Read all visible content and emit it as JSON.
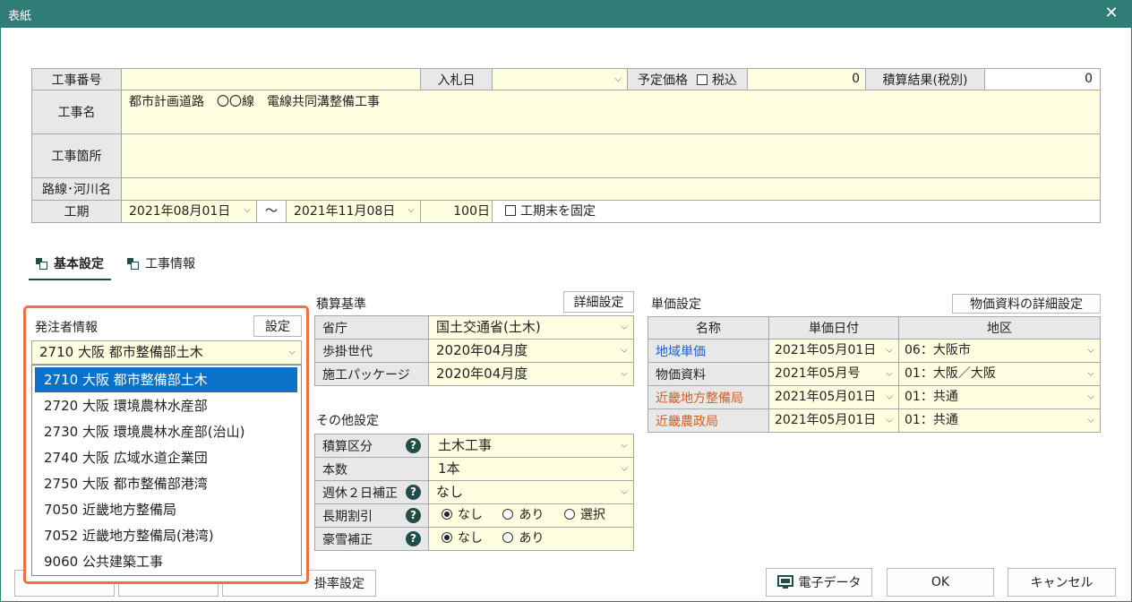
{
  "window": {
    "title": "表紙",
    "close_icon": "close-icon"
  },
  "header": {
    "koji_bango_label": "工事番号",
    "nyusatsu_label": "入札日",
    "yotei_kakaku_label": "予定価格",
    "zeikomi_label": "税込",
    "yotei_kakaku_value": "0",
    "sekisan_kekka_label": "積算結果(税別)",
    "sekisan_kekka_value": "0",
    "koji_mei_label": "工事名",
    "koji_mei_value": "都市計画道路　〇〇線　電線共同溝整備工事",
    "koji_kasho_label": "工事箇所",
    "rosen_label": "路線･河川名",
    "koki_label": "工期",
    "koki_start": "2021年08月01日",
    "koki_tilde": "～",
    "koki_end": "2021年11月08日",
    "koki_days": "100日",
    "koki_fix_label": "工期末を固定"
  },
  "tabs": {
    "basic": "基本設定",
    "koji_info": "工事情報"
  },
  "client": {
    "title": "発注者情報",
    "settings_button": "設定",
    "selected": "2710 大阪 都市整備部土木",
    "options": [
      "2710 大阪 都市整備部土木",
      "2720 大阪 環境農林水産部",
      "2730 大阪 環境農林水産部(治山)",
      "2740 大阪 広域水道企業団",
      "2750 大阪 都市整備部港湾",
      "7050 近畿地方整備局",
      "7052 近畿地方整備局(港湾)",
      "9060 公共建築工事"
    ]
  },
  "sekisan_kijun": {
    "title": "積算基準",
    "detail_button": "詳細設定",
    "rows": [
      {
        "label": "省庁",
        "value": "国土交通省(土木)"
      },
      {
        "label": "歩掛世代",
        "value": "2020年04月度"
      },
      {
        "label": "施工パッケージ",
        "value": "2020年04月度"
      }
    ]
  },
  "other": {
    "title": "その他設定",
    "sekisan_kubun_label": "積算区分",
    "sekisan_kubun_value": "土木工事",
    "honsu_label": "本数",
    "honsu_value": "1本",
    "shukyu_label": "週休２日補正",
    "shukyu_value": "なし",
    "choki_label": "長期割引",
    "gosetsu_label": "豪雪補正",
    "opt_nashi": "なし",
    "opt_ari": "あり",
    "opt_sentaku": "選択"
  },
  "tanka": {
    "title": "単価設定",
    "detail_button": "物価資料の詳細設定",
    "headers": [
      "名称",
      "単価日付",
      "地区"
    ],
    "rows": [
      {
        "name": "地域単価",
        "date": "2021年05月01日",
        "area": "06：大阪市"
      },
      {
        "name": "物価資料",
        "date": "2021年05月号",
        "area": "01：大阪／大阪"
      },
      {
        "name": "近畿地方整備局",
        "date": "2021年05月01日",
        "area": "01：共通"
      },
      {
        "name": "近畿農政局",
        "date": "2021年05月01日",
        "area": "01：共通"
      }
    ]
  },
  "footer": {
    "kakeritsu_button": "掛率設定",
    "denshi_button": "電子データ",
    "ok_button": "OK",
    "cancel_button": "キャンセル"
  },
  "colors": {
    "titlebar": "#2f7d76",
    "input_bg": "#fefee0",
    "selected": "#0b71c9",
    "highlight": "#f07040",
    "link_blue": "#1e5fd6",
    "link_orange": "#d06020"
  }
}
